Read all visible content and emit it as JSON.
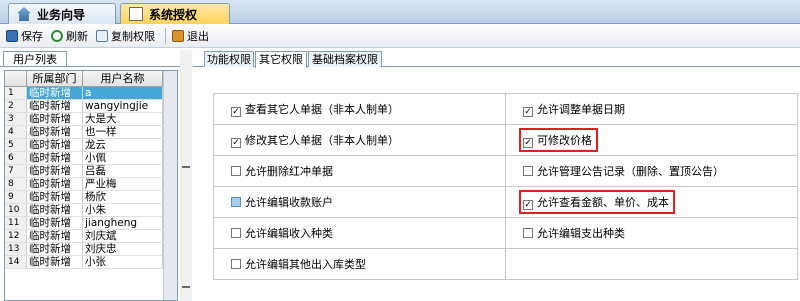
{
  "top_tabs": [
    {
      "label": "业务向导",
      "icon": "house-icon"
    },
    {
      "label": "系统授权",
      "icon": "document-icon"
    }
  ],
  "toolbar": {
    "save": "保存",
    "refresh": "刷新",
    "copy": "复制权限",
    "exit": "退出"
  },
  "left": {
    "tab": "用户列表",
    "columns": [
      "所属部门",
      "用户名称"
    ],
    "rows": [
      {
        "n": "1",
        "dept": "临时新增",
        "name": "a"
      },
      {
        "n": "2",
        "dept": "临时新增",
        "name": "wangyingjie"
      },
      {
        "n": "3",
        "dept": "临时新增",
        "name": "大是大"
      },
      {
        "n": "4",
        "dept": "临时新增",
        "name": "也一样"
      },
      {
        "n": "5",
        "dept": "临时新增",
        "name": "龙云"
      },
      {
        "n": "6",
        "dept": "临时新增",
        "name": "小佩"
      },
      {
        "n": "7",
        "dept": "临时新增",
        "name": "吕磊"
      },
      {
        "n": "8",
        "dept": "临时新增",
        "name": "严业梅"
      },
      {
        "n": "9",
        "dept": "临时新增",
        "name": "杨欣"
      },
      {
        "n": "10",
        "dept": "临时新增",
        "name": "小朱"
      },
      {
        "n": "11",
        "dept": "临时新增",
        "name": "jiangheng"
      },
      {
        "n": "12",
        "dept": "临时新增",
        "name": "刘庆斌"
      },
      {
        "n": "13",
        "dept": "临时新增",
        "name": "刘庆忠"
      },
      {
        "n": "14",
        "dept": "临时新增",
        "name": "小张"
      }
    ]
  },
  "right_tabs": [
    "功能权限",
    "其它权限",
    "基础档案权限"
  ],
  "permissions": [
    [
      "查看其它人单据（非本人制单）",
      "允许调整单据日期"
    ],
    [
      "修改其它人单据（非本人制单）",
      "可修改价格"
    ],
    [
      "允许删除红冲单据",
      "允许管理公告记录（删除、置顶公告）"
    ],
    [
      "允许编辑收款账户",
      "允许查看金额、单价、成本"
    ],
    [
      "允许编辑收入种类",
      "允许编辑支出种类"
    ],
    [
      "允许编辑其他出入库类型",
      ""
    ]
  ]
}
